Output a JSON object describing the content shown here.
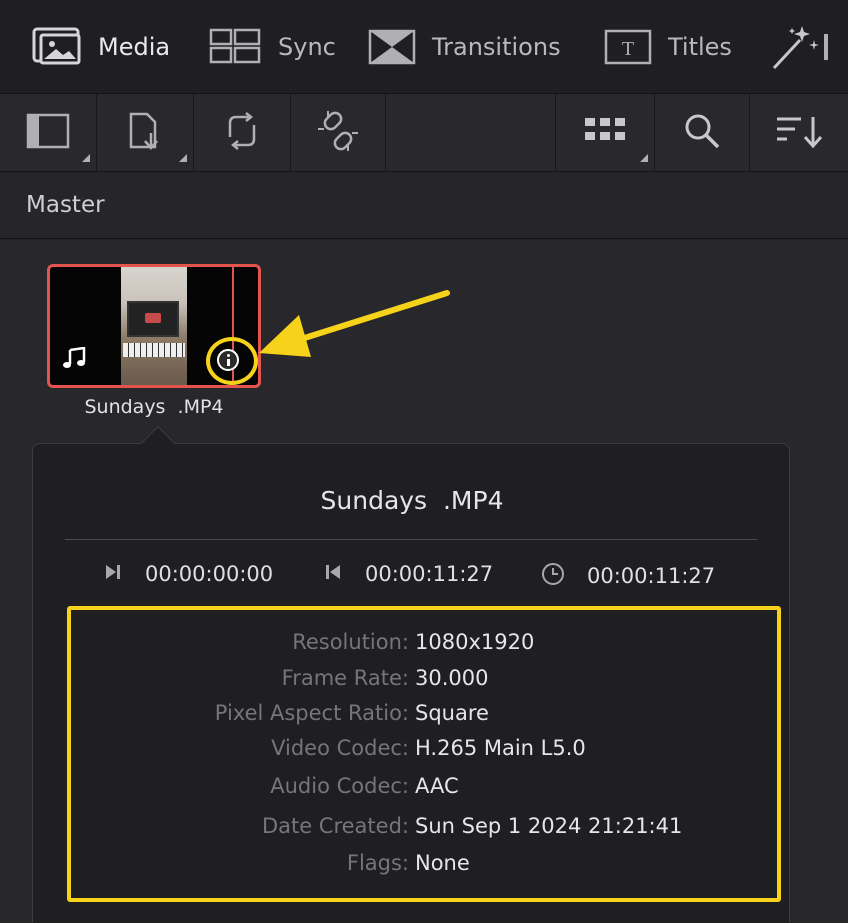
{
  "tabs": [
    {
      "label": "Media",
      "icon": "media-pool-icon",
      "active": true
    },
    {
      "label": "Sync",
      "icon": "sync-bin-icon",
      "active": false
    },
    {
      "label": "Transitions",
      "icon": "transitions-icon",
      "active": false
    },
    {
      "label": "Titles",
      "icon": "titles-icon",
      "active": false
    },
    {
      "label": "",
      "icon": "effects-icon",
      "active": false
    }
  ],
  "toolbar": {
    "icons": [
      "sidebar-toggle-icon",
      "import-media-icon",
      "relink-icon",
      "unlink-icon",
      "view-mode-grid-icon",
      "search-icon",
      "sort-icon"
    ]
  },
  "bin": {
    "title": "Master"
  },
  "clip": {
    "name": "Sundays  .MP4",
    "has_audio": true
  },
  "info_panel": {
    "title": "Sundays  .MP4",
    "timecodes": {
      "start": "00:00:00:00",
      "end": "00:00:11:27",
      "duration": "00:00:11:27"
    },
    "metadata": [
      {
        "label": "Resolution:",
        "value": "1080x1920"
      },
      {
        "label": "Frame Rate:",
        "value": "30.000"
      },
      {
        "label": "Pixel Aspect Ratio:",
        "value": "Square"
      },
      {
        "label": "Video Codec:",
        "value": "H.265 Main L5.0"
      },
      {
        "label": "Audio Codec:",
        "value": "AAC"
      },
      {
        "label": "Date Created:",
        "value": "Sun Sep 1 2024 21:21:41"
      },
      {
        "label": "Flags:",
        "value": "None"
      }
    ]
  },
  "colors": {
    "highlight": "#f7d21a",
    "clip_selected_border": "#e2544c"
  }
}
